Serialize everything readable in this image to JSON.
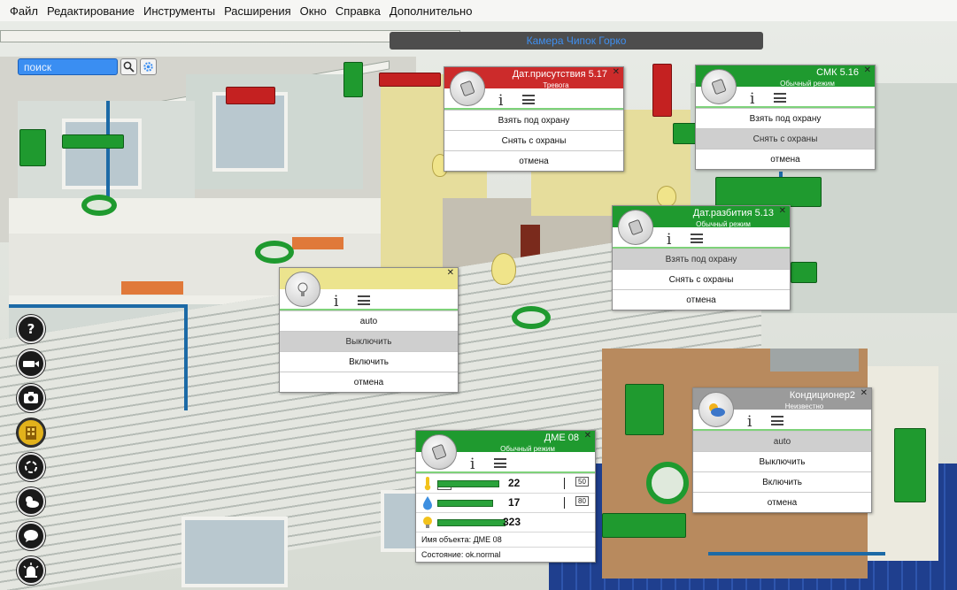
{
  "menu": [
    "Файл",
    "Редактирование",
    "Инструменты",
    "Расширения",
    "Окно",
    "Справка",
    "Дополнительно"
  ],
  "search": {
    "placeholder": "поиск"
  },
  "camera_label": "Камера Чипок Горко",
  "colors": {
    "ok": "#1f9a2f",
    "alarm": "#cc2b2b",
    "warning": "#ece48e",
    "unknown": "#9b9b9b",
    "search_bg": "#3a8ef2"
  },
  "tools": [
    "help-icon",
    "camera-icon",
    "screenshot-icon",
    "building-icon",
    "rotate-icon",
    "weather-icon",
    "chat-icon",
    "alarm-light-icon"
  ],
  "popups": {
    "presence": {
      "title": "Дат.присутствия 5.17",
      "subtitle": "Тревога",
      "status_color": "#cc2b2b",
      "icon": "sensor-icon",
      "actions": [
        "Взять под охрану",
        "Снять с охраны",
        "отмена"
      ],
      "selected": ""
    },
    "smk": {
      "title": "СМК 5.16",
      "subtitle": "Обычный режим",
      "status_color": "#1f9a2f",
      "icon": "sensor-icon",
      "actions": [
        "Взять под охрану",
        "Снять с охраны",
        "отмена"
      ],
      "selected": "Снять с охраны"
    },
    "glassbreak": {
      "title": "Дат.разбития 5.13",
      "subtitle": "Обычный режим",
      "status_color": "#1f9a2f",
      "icon": "sensor-icon",
      "actions": [
        "Взять под охрану",
        "Снять с охраны",
        "отмена"
      ],
      "selected": "Взять под охрану"
    },
    "light": {
      "title": "",
      "subtitle": "",
      "status_color": "#ece48e",
      "icon": "lightbulb-icon",
      "actions": [
        "auto",
        "Выключить",
        "Включить",
        "отмена"
      ],
      "selected": "Выключить"
    },
    "ac": {
      "title": "Кондиционер2",
      "subtitle": "Неизвестно",
      "status_color": "#9b9b9b",
      "icon": "weather-icon",
      "actions": [
        "auto",
        "Выключить",
        "Включить",
        "отмена"
      ],
      "selected": "auto"
    },
    "dme": {
      "title": "ДМЕ 08",
      "subtitle": "Обычный режим",
      "status_color": "#1f9a2f",
      "icon": "sensor-icon",
      "meters": [
        {
          "icon": "thermometer-icon",
          "value": "22",
          "min": "-10",
          "max": "50",
          "fill": 0.5
        },
        {
          "icon": "humidity-icon",
          "value": "17",
          "max": "80",
          "fill": 0.45
        },
        {
          "icon": "lightbulb-icon",
          "value": "323",
          "fill": 0.55
        }
      ],
      "object_name": "Имя объекта: ДМЕ 08",
      "state": "Состояние: ok.normal"
    }
  }
}
